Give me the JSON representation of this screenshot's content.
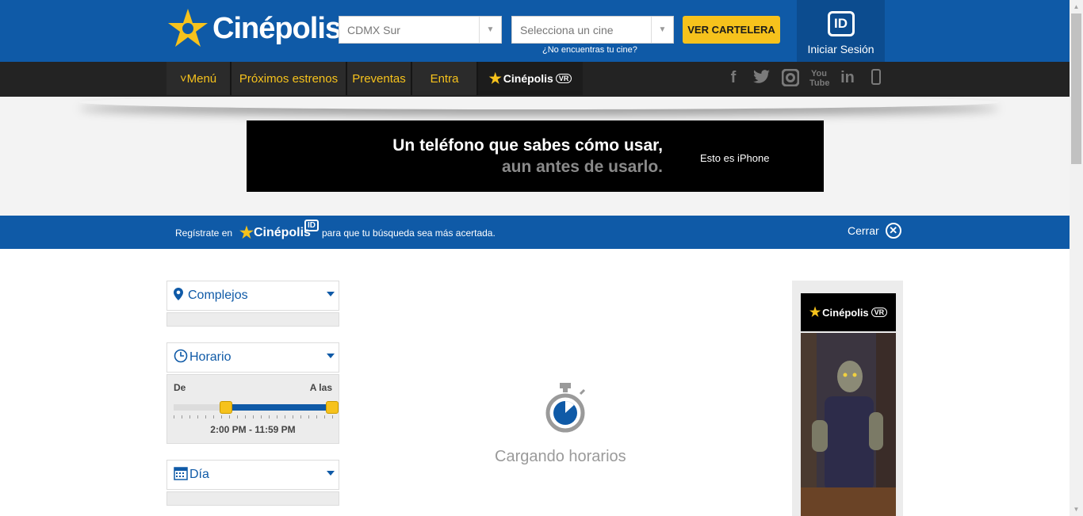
{
  "header": {
    "brand": "Cinépolis",
    "city_select": "CDMX Sur",
    "cinema_select_placeholder": "Selecciona un cine",
    "cartelera_button": "VER CARTELERA",
    "no_encuentras": "¿No encuentras tu cine?",
    "login_badge": "ID",
    "login_label": "Iniciar Sesión"
  },
  "nav": {
    "menu": "˅Menú",
    "proximos": "Próximos estrenos",
    "preventas": "Preventas",
    "entra": "Entra",
    "vr_brand": "Cinépolis",
    "vr_tag": "VR"
  },
  "social": [
    "facebook-icon",
    "twitter-icon",
    "instagram-icon",
    "youtube-icon",
    "linkedin-icon",
    "mobile-icon"
  ],
  "ad": {
    "line1": "Un teléfono que sabes cómo usar,",
    "line2": "aun antes de usarlo.",
    "tagline": "Esto es iPhone"
  },
  "register": {
    "prefix": "Regístrate en",
    "brand": "Cinépolis",
    "badge": "ID",
    "suffix": "para que tu búsqueda sea más acertada.",
    "close": "Cerrar"
  },
  "filters": {
    "complejos": "Complejos",
    "horario": "Horario",
    "de": "De",
    "a_las": "A las",
    "range": "2:00 PM - 11:59 PM",
    "range_start_fraction": 0.33,
    "range_end_fraction": 1.0,
    "dia": "Día"
  },
  "loading": "Cargando horarios",
  "side_ad": {
    "brand": "Cinépolis",
    "tag": "VR"
  },
  "colors": {
    "primary": "#0f5aa7",
    "accent": "#f6c21c",
    "nav_bg": "#232323"
  }
}
